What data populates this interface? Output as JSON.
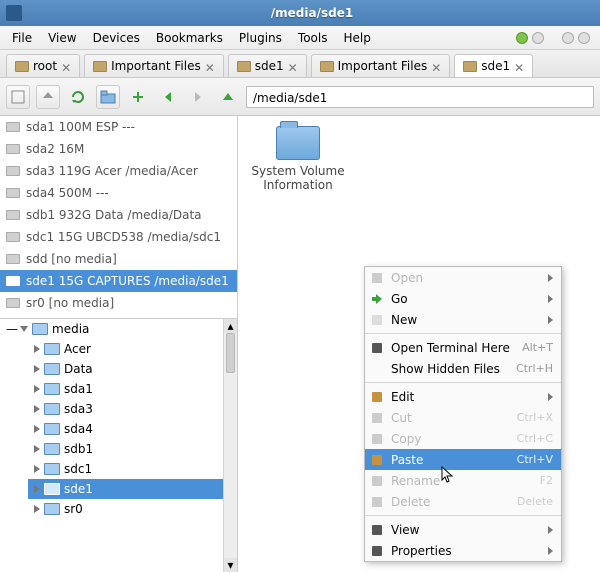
{
  "window": {
    "title": "/media/sde1"
  },
  "menu": {
    "items": [
      "File",
      "View",
      "Devices",
      "Bookmarks",
      "Plugins",
      "Tools",
      "Help"
    ]
  },
  "tabs": [
    {
      "label": "root",
      "active": false
    },
    {
      "label": "Important Files",
      "active": false
    },
    {
      "label": "sde1",
      "active": false
    },
    {
      "label": "Important Files",
      "active": false
    },
    {
      "label": "sde1",
      "active": true
    }
  ],
  "path": {
    "value": "/media/sde1"
  },
  "devices": [
    {
      "label": "sda1 100M ESP ---",
      "selected": false
    },
    {
      "label": "sda2 16M",
      "selected": false
    },
    {
      "label": "sda3 119G Acer /media/Acer",
      "selected": false
    },
    {
      "label": "sda4 500M ---",
      "selected": false
    },
    {
      "label": "sdb1 932G Data /media/Data",
      "selected": false
    },
    {
      "label": "sdc1 15G UBCD538 /media/sdc1",
      "selected": false
    },
    {
      "label": "sdd [no media]",
      "selected": false
    },
    {
      "label": "sde1 15G CAPTURES /media/sde1",
      "selected": true
    },
    {
      "label": "sr0 [no media]",
      "selected": false
    }
  ],
  "tree": {
    "root": "media",
    "children": [
      "Acer",
      "Data",
      "sda1",
      "sda3",
      "sda4",
      "sdb1",
      "sdc1",
      "sde1",
      "sr0"
    ],
    "selected": "sde1"
  },
  "main": {
    "items": [
      {
        "name": "System Volume Information"
      }
    ]
  },
  "context_menu": [
    {
      "label": "Open",
      "icon": "open-icon",
      "disabled": true,
      "submenu": true
    },
    {
      "label": "Go",
      "icon": "go-icon",
      "submenu": true
    },
    {
      "label": "New",
      "icon": "new-icon",
      "submenu": true
    },
    {
      "sep": true
    },
    {
      "label": "Open Terminal Here",
      "icon": "terminal-icon",
      "shortcut": "Alt+T"
    },
    {
      "label": "Show Hidden Files",
      "shortcut": "Ctrl+H"
    },
    {
      "sep": true
    },
    {
      "label": "Edit",
      "icon": "edit-icon",
      "submenu": true
    },
    {
      "label": "Cut",
      "icon": "cut-icon",
      "disabled": true,
      "shortcut": "Ctrl+X"
    },
    {
      "label": "Copy",
      "icon": "copy-icon",
      "disabled": true,
      "shortcut": "Ctrl+C"
    },
    {
      "label": "Paste",
      "icon": "paste-icon",
      "shortcut": "Ctrl+V",
      "highlight": true
    },
    {
      "label": "Rename",
      "icon": "rename-icon",
      "disabled": true,
      "shortcut": "F2"
    },
    {
      "label": "Delete",
      "icon": "delete-icon",
      "disabled": true,
      "shortcut": "Delete"
    },
    {
      "sep": true
    },
    {
      "label": "View",
      "icon": "view-icon",
      "submenu": true
    },
    {
      "label": "Properties",
      "icon": "properties-icon",
      "submenu": true
    }
  ]
}
